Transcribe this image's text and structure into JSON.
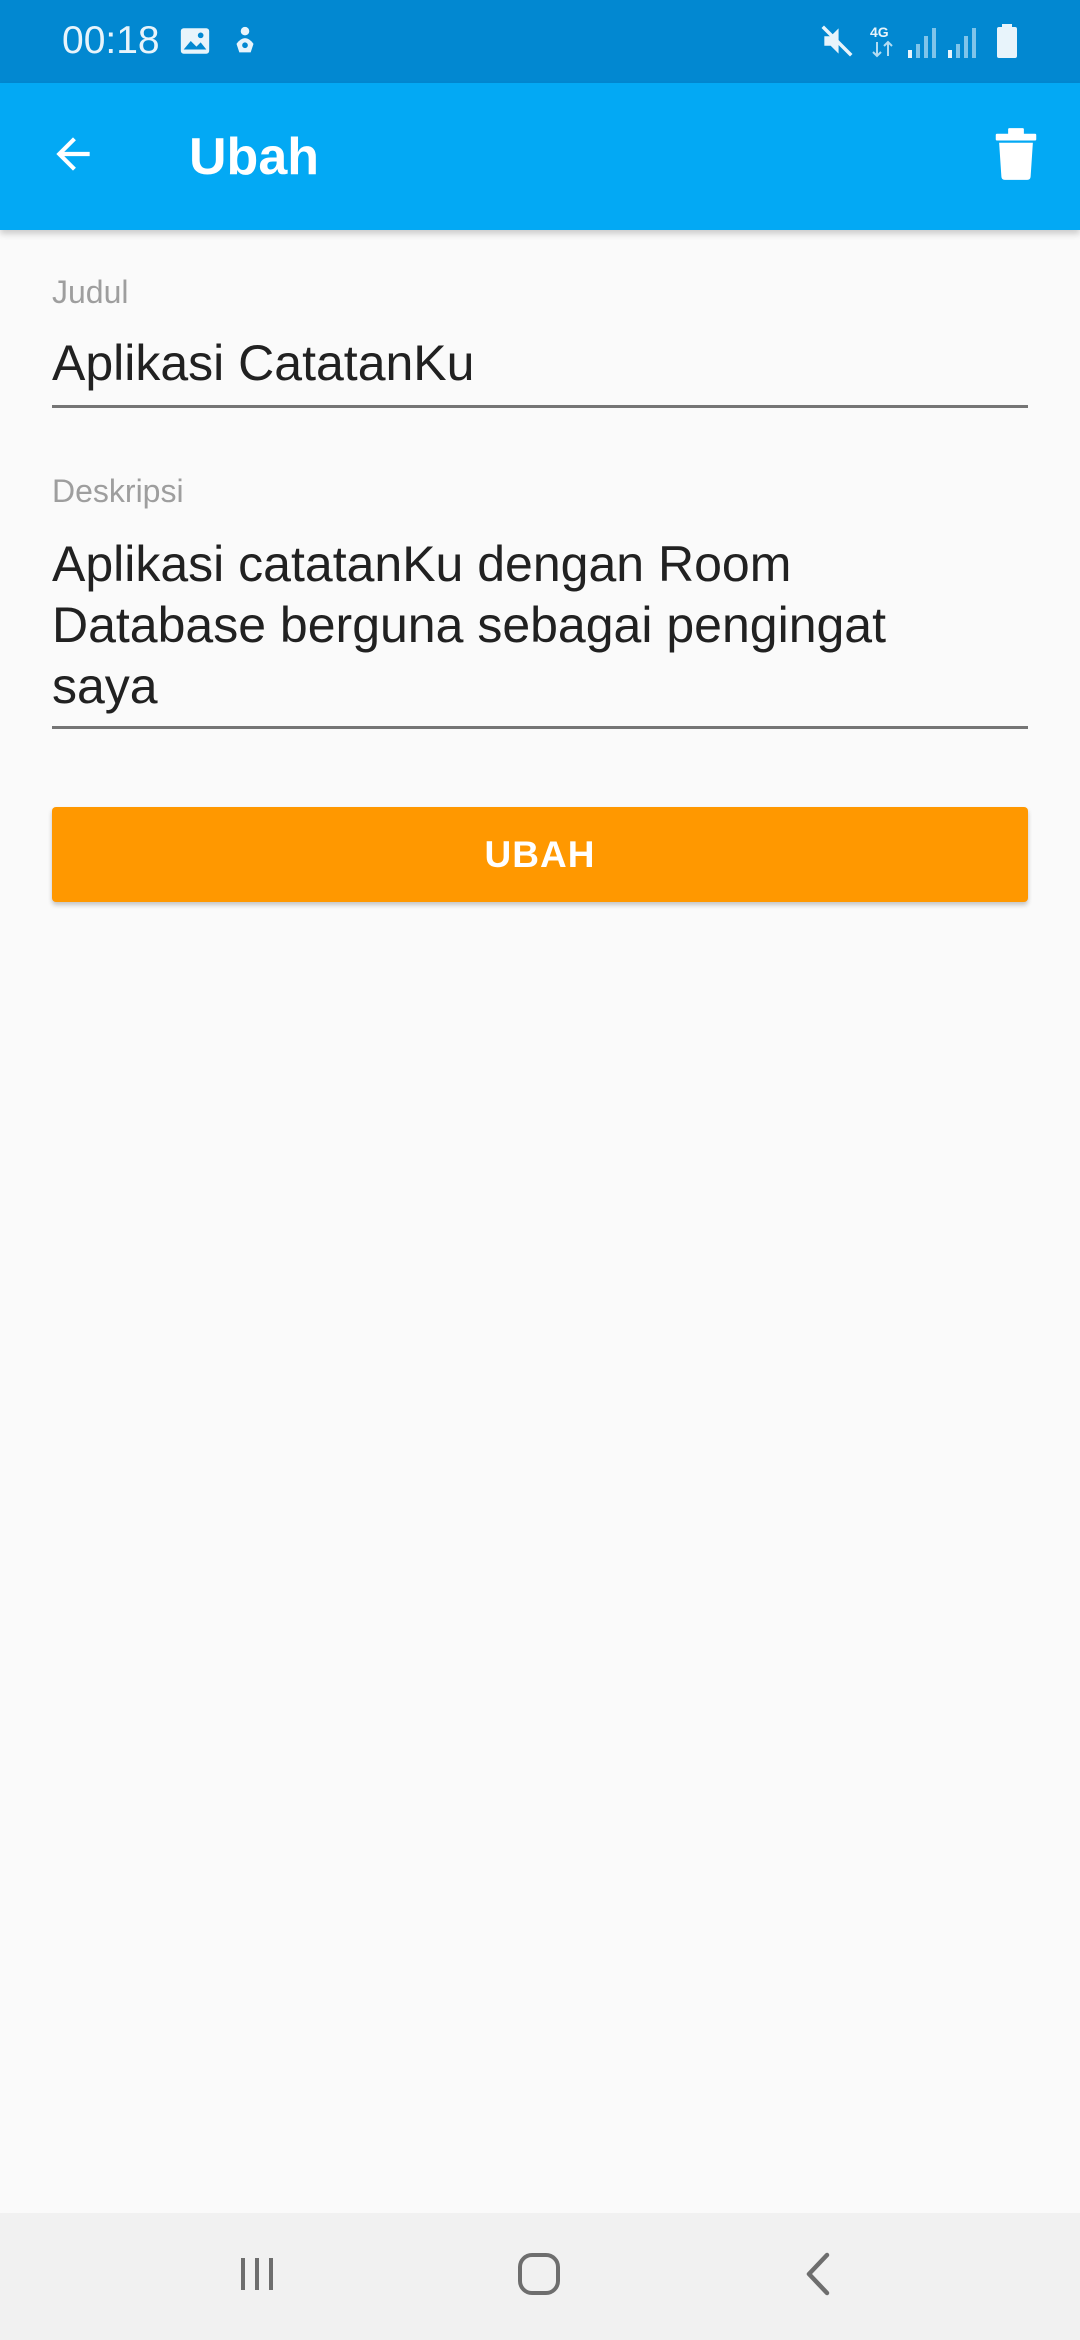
{
  "status_bar": {
    "time": "00:18",
    "icons": [
      "image-icon",
      "notification-icon",
      "mute-icon",
      "network-4g-icon",
      "signal-icon",
      "signal-icon",
      "battery-icon"
    ],
    "network_label": "4G"
  },
  "app_bar": {
    "title": "Ubah",
    "back_icon": "arrow-back-icon",
    "delete_icon": "trash-icon",
    "background_color": "#03a9f4",
    "status_color": "#0288d1"
  },
  "form": {
    "title_label": "Judul",
    "title_value": "Aplikasi CatatanKu",
    "description_label": "Deskripsi",
    "description_value": "Aplikasi catatanKu dengan Room Database berguna sebagai pengingat saya",
    "submit_label": "UBAH",
    "submit_color": "#ff9800"
  },
  "nav_bar": {
    "icons": [
      "recent-apps-icon",
      "home-icon",
      "back-icon"
    ]
  }
}
